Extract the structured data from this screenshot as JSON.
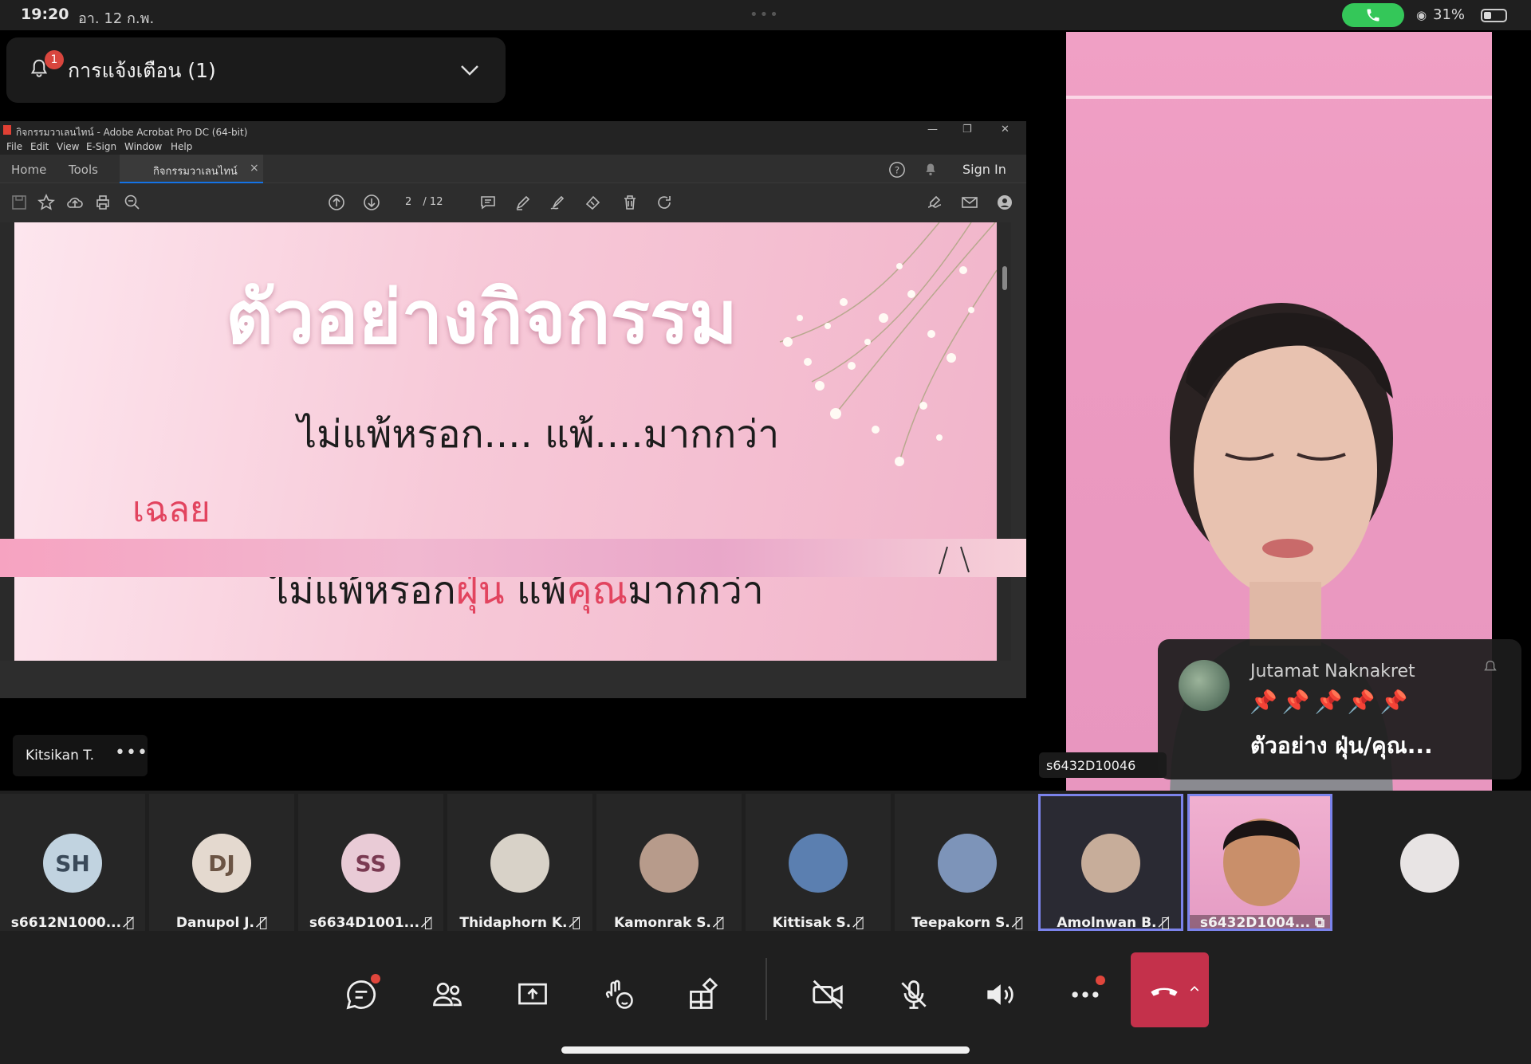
{
  "status_bar": {
    "time": "19:20",
    "date": "อา. 12 ก.พ.",
    "battery": "31%",
    "call_active_color": "#34c759"
  },
  "notification": {
    "label": "การแจ้งเตือน (1)",
    "badge_count": "1"
  },
  "acrobat": {
    "window_title": "กิจกรรมวาเลนไทน์ - Adobe Acrobat Pro DC (64-bit)",
    "menu": [
      "File",
      "Edit",
      "View",
      "E-Sign",
      "Window",
      "Help"
    ],
    "tabs": {
      "home": "Home",
      "tools": "Tools",
      "doc": "กิจกรรมวาเลนไทน์"
    },
    "sign_in": "Sign In",
    "page_current": "2",
    "page_total": "/ 12"
  },
  "slide": {
    "title": "ตัวอย่างกิจกรรม",
    "question": "ไม่แพ้หรอก.... แพ้....มากกว่า",
    "answer_label": "เฉลย",
    "answer_parts": [
      "ไม่แพ้หรอก",
      "ฝุ่น",
      " แพ้",
      "คุณ",
      "มากกว่า"
    ],
    "accent_color": "#e2445f"
  },
  "presenter": {
    "name": "Kitsikan T.",
    "more": "•••"
  },
  "video": {
    "participant": "s6432D10046"
  },
  "chat_popup": {
    "sender": "Jutamat Naknakret",
    "pins": "📌📌📌📌📌",
    "message": "ตัวอย่าง   ฝุ่น/คุณ..."
  },
  "participants": [
    {
      "initials": "SH",
      "name": "s6612N1000...",
      "avatar_bg": "#c1d3e0",
      "avatar_fg": "#3a4a5a",
      "type": "initials"
    },
    {
      "initials": "DJ",
      "name": "Danupol J.",
      "avatar_bg": "#e4d9cf",
      "avatar_fg": "#6b5444",
      "type": "initials"
    },
    {
      "initials": "SS",
      "name": "s6634D1001...",
      "avatar_bg": "#e9cbd6",
      "avatar_fg": "#7a3a52",
      "type": "initials"
    },
    {
      "initials": "",
      "name": "Thidaphorn K.",
      "avatar_bg": "#d8d2c8",
      "type": "photo"
    },
    {
      "initials": "",
      "name": "Kamonrak S.",
      "avatar_bg": "#b79b8b",
      "type": "photo"
    },
    {
      "initials": "",
      "name": "Kittisak S.",
      "avatar_bg": "#5b7fb0",
      "type": "photo"
    },
    {
      "initials": "",
      "name": "Teepakorn S.",
      "avatar_bg": "#7d94b9",
      "type": "photo"
    },
    {
      "initials": "",
      "name": "Amolnwan B.",
      "avatar_bg": "#c7ad9a",
      "type": "photo",
      "selected": true
    },
    {
      "initials": "",
      "name": "s6432D1004...",
      "type": "video",
      "selected": true
    },
    {
      "initials": "",
      "name": "",
      "avatar_bg": "#e8e4e4",
      "type": "photo"
    }
  ],
  "controls": [
    "chat-icon",
    "people-icon",
    "share-icon",
    "reactions-icon",
    "apps-icon",
    "camera-off-icon",
    "mic-off-icon",
    "speaker-icon",
    "more-icon",
    "hangup-icon"
  ],
  "hangup_color": "#c4314b"
}
